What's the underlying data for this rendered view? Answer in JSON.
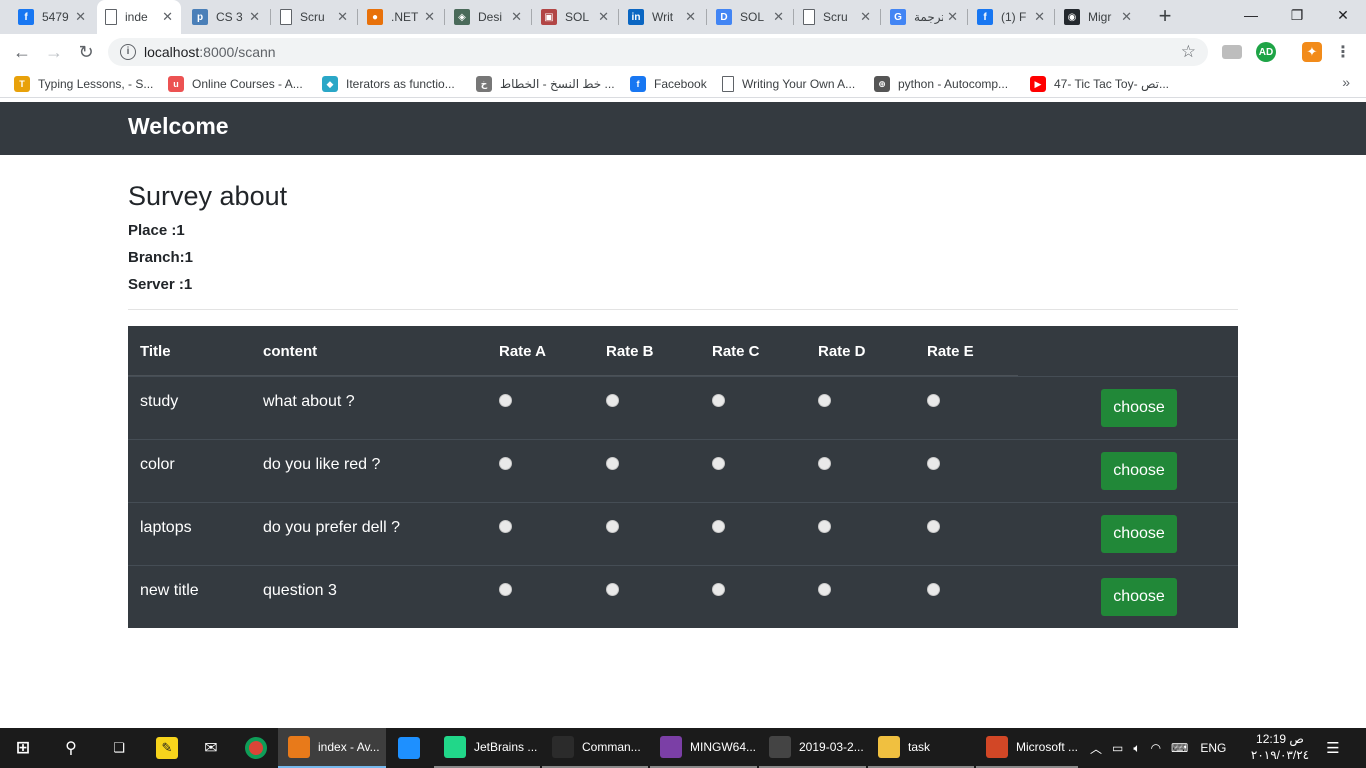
{
  "browser": {
    "tabs": [
      {
        "title": "5479",
        "icon": "facebook-icon",
        "color": "#1877f2",
        "glyph": "f"
      },
      {
        "title": "inde",
        "icon": "page-icon",
        "color": "#ffffff",
        "glyph": "",
        "active": true
      },
      {
        "title": "CS 3",
        "icon": "p-icon",
        "color": "#4a7fb8",
        "glyph": "p"
      },
      {
        "title": "Scru",
        "icon": "page-icon",
        "color": "#ffffff",
        "glyph": ""
      },
      {
        "title": ".NET",
        "icon": "dotnet-icon",
        "color": "#e8710a",
        "glyph": "●"
      },
      {
        "title": "Desi",
        "icon": "diamond-icon",
        "color": "#4a6a5a",
        "glyph": "◈"
      },
      {
        "title": "SOL",
        "icon": "board-icon",
        "color": "#b24545",
        "glyph": "▣"
      },
      {
        "title": "Writ",
        "icon": "linkedin-icon",
        "color": "#0a66c2",
        "glyph": "in"
      },
      {
        "title": "SOL",
        "icon": "d-icon",
        "color": "#4285f4",
        "glyph": "D"
      },
      {
        "title": "Scru",
        "icon": "page-icon",
        "color": "#ffffff",
        "glyph": ""
      },
      {
        "title": "ترجمة",
        "icon": "translate-icon",
        "color": "#4285f4",
        "glyph": "G"
      },
      {
        "title": "(1) F",
        "icon": "facebook-icon",
        "color": "#1877f2",
        "glyph": "f"
      },
      {
        "title": "Migr",
        "icon": "github-icon",
        "color": "#24292e",
        "glyph": "◉"
      }
    ],
    "new_tab": "+",
    "window": {
      "minimize": "—",
      "restore": "❐",
      "close": "✕"
    },
    "back": "←",
    "forward": "→",
    "reload": "↻",
    "url_host": "localhost",
    "url_path": ":8000/scann",
    "star": "☆",
    "profile_badge": "AD",
    "bookmarks": [
      {
        "label": "Typing Lessons, - S...",
        "color": "#e8a10a",
        "glyph": "T"
      },
      {
        "label": "Online Courses - A...",
        "color": "#ec5252",
        "glyph": "u"
      },
      {
        "label": "Iterators as functio...",
        "color": "#2aa7c7",
        "glyph": "◆"
      },
      {
        "label": "خط النسخ - الخطاط ...",
        "color": "#777777",
        "glyph": "خ"
      },
      {
        "label": "Facebook",
        "color": "#1877f2",
        "glyph": "f"
      },
      {
        "label": "Writing Your Own A...",
        "color": "#ffffff",
        "glyph": ""
      },
      {
        "label": "python - Autocomp...",
        "color": "#555555",
        "glyph": "⊕"
      },
      {
        "label": "47- Tic Tac Toy- تص...",
        "color": "#ff0000",
        "glyph": "▶"
      }
    ],
    "bookmarks_more": "»"
  },
  "site": {
    "brand": "Welcome",
    "survey_title": "Survey about",
    "place": "Place :1",
    "branch": "Branch:1",
    "server": "Server :1"
  },
  "table": {
    "headers": [
      "Title",
      "content",
      "Rate A",
      "Rate B",
      "Rate C",
      "Rate D",
      "Rate E"
    ],
    "button_label": "choose",
    "rows": [
      {
        "title": "study",
        "content": "what about ?"
      },
      {
        "title": "color",
        "content": "do you like red ?"
      },
      {
        "title": "laptops",
        "content": "do you prefer dell ?"
      },
      {
        "title": "new title",
        "content": "question 3"
      }
    ]
  },
  "taskbar": {
    "apps": [
      {
        "label": "index - Av...",
        "icon": "avast-browser-icon",
        "color": "#e87a1a",
        "state": "active"
      },
      {
        "label": "",
        "icon": "edge-icon",
        "color": "#1e90ff",
        "state": "none"
      },
      {
        "label": "JetBrains ...",
        "icon": "pycharm-icon",
        "color": "#21d789",
        "state": "running"
      },
      {
        "label": "Comman...",
        "icon": "cmd-icon",
        "color": "#2b2b2b",
        "state": "running"
      },
      {
        "label": "MINGW64...",
        "icon": "git-icon",
        "color": "#7b3fa6",
        "state": "running"
      },
      {
        "label": "2019-03-2...",
        "icon": "photos-icon",
        "color": "#ffffff",
        "state": "running"
      },
      {
        "label": "task",
        "icon": "folder-icon",
        "color": "#f0c040",
        "state": "running"
      },
      {
        "label": "Microsoft ...",
        "icon": "powerpoint-icon",
        "color": "#d24726",
        "state": "running"
      }
    ],
    "language": "ENG",
    "time": "12:19 ص",
    "date": "٢٠١٩/٠٣/٢٤"
  }
}
